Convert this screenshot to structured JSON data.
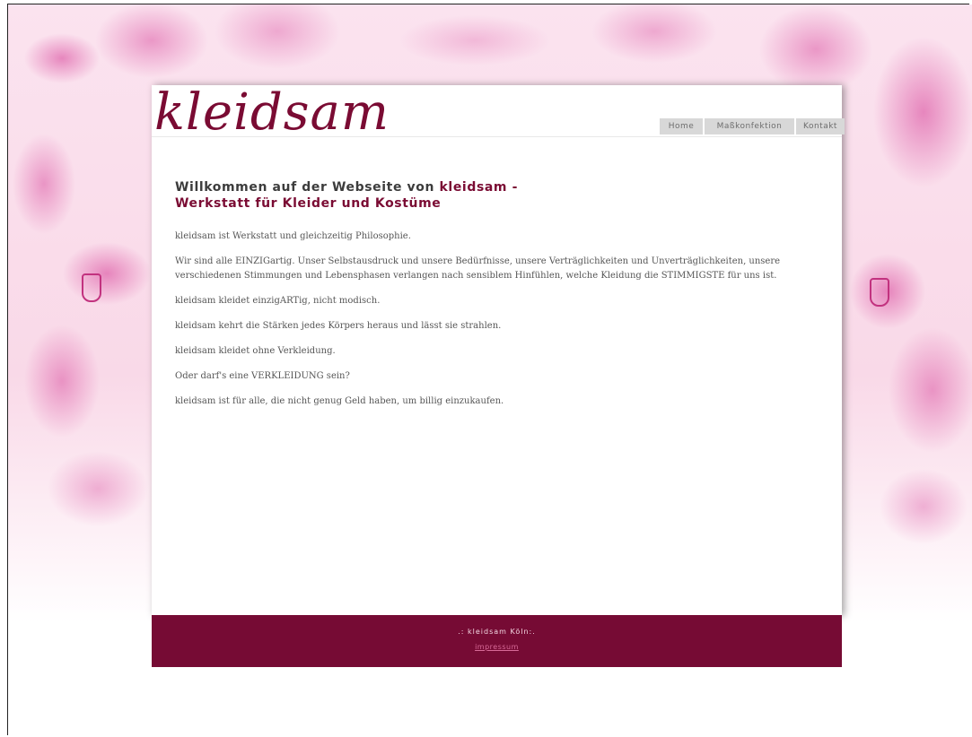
{
  "site": {
    "logo_text": "kleidsam"
  },
  "nav": {
    "items": [
      {
        "label": "Home"
      },
      {
        "label": "Maßkonfektion"
      },
      {
        "label": "Kontakt"
      }
    ]
  },
  "main": {
    "title_part1": "Willkommen auf der Webseite von ",
    "title_brand": "kleidsam -",
    "title_line2": "Werkstatt für Kleider und Kostüme",
    "paragraphs": [
      "kleidsam ist Werkstatt und gleichzeitig Philosophie.",
      "Wir sind alle EINZIGartig. Unser Selbstausdruck und unsere Bedürfnisse, unsere Verträglichkeiten und Unverträglichkeiten, unsere verschiedenen Stimmungen und Lebensphasen verlangen nach sensiblem Hinfühlen, welche Kleidung die STIMMIGSTE für uns ist.",
      "kleidsam kleidet einzigARTig, nicht modisch.",
      "kleidsam kehrt die Stärken jedes Körpers heraus und lässt sie strahlen.",
      "kleidsam kleidet ohne Verkleidung.",
      "Oder darf's eine VERKLEIDUNG sein?",
      "kleidsam ist für alle, die nicht genug Geld haben, um billig einzukaufen."
    ]
  },
  "footer": {
    "title": ".: kleidsam Köln:.",
    "link": "impressum"
  },
  "colors": {
    "brand": "#760b34",
    "accent_pink": "#d63c96"
  }
}
